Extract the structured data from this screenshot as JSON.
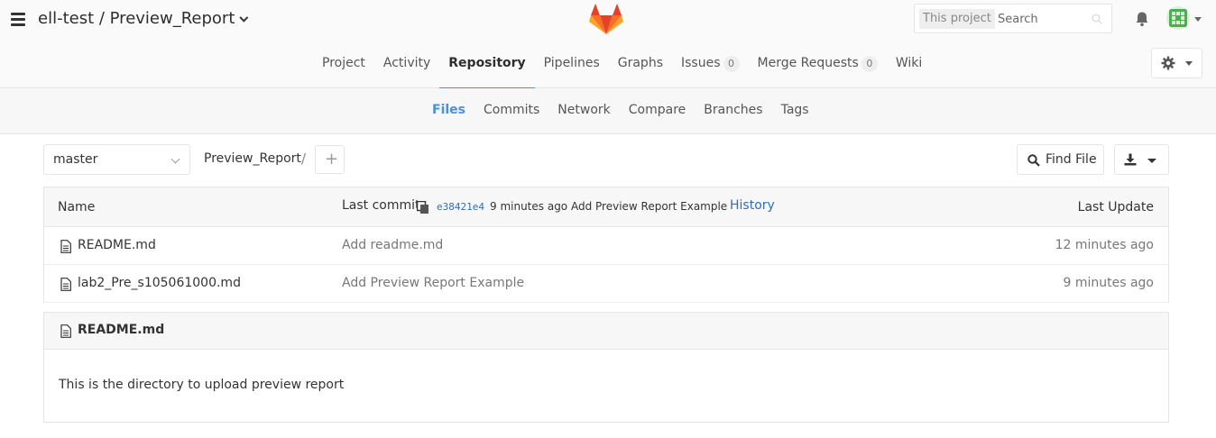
{
  "header": {
    "project_title": "ell-test / Preview_Report",
    "search_scope": "This project",
    "search_placeholder": "Search"
  },
  "main_nav": [
    {
      "label": "Project",
      "active": false
    },
    {
      "label": "Activity",
      "active": false
    },
    {
      "label": "Repository",
      "active": true
    },
    {
      "label": "Pipelines",
      "active": false
    },
    {
      "label": "Graphs",
      "active": false
    },
    {
      "label": "Issues",
      "badge": "0",
      "active": false
    },
    {
      "label": "Merge Requests",
      "badge": "0",
      "active": false
    },
    {
      "label": "Wiki",
      "active": false
    }
  ],
  "sub_nav": [
    {
      "label": "Files",
      "active": true
    },
    {
      "label": "Commits",
      "active": false
    },
    {
      "label": "Network",
      "active": false
    },
    {
      "label": "Compare",
      "active": false
    },
    {
      "label": "Branches",
      "active": false
    },
    {
      "label": "Tags",
      "active": false
    }
  ],
  "tree": {
    "branch": "master",
    "breadcrumb": "Preview_Report",
    "breadcrumb_sep": "/",
    "add_symbol": "+",
    "find_file_label": "Find File"
  },
  "table": {
    "col_name": "Name",
    "col_last_commit": "Last commit",
    "commit_sha": "e38421e4",
    "commit_message": "9 minutes ago Add Preview Report Example",
    "history_label": "History",
    "col_last_update": "Last Update",
    "rows": [
      {
        "name": "README.md",
        "commit": "Add readme.md",
        "updated": "12 minutes ago"
      },
      {
        "name": "lab2_Pre_s105061000.md",
        "commit": "Add Preview Report Example",
        "updated": "9 minutes ago"
      }
    ]
  },
  "readme": {
    "title": "README.md",
    "content": "This is the directory to upload preview report"
  },
  "colors": {
    "accent": "#4a90d9",
    "link": "#2f70b5",
    "logo_orange": "#fc6d26",
    "logo_red": "#e24329",
    "logo_light": "#fca326"
  },
  "icons": [
    "hamburger-icon",
    "gitlab-logo",
    "search-icon",
    "bell-icon",
    "avatar",
    "gear-icon",
    "search-icon",
    "download-icon",
    "copy-icon",
    "file-icon"
  ]
}
